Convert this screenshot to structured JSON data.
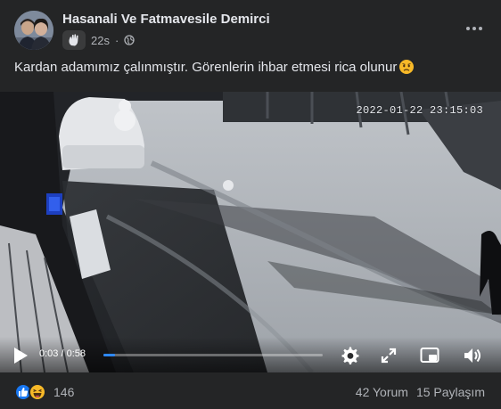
{
  "post": {
    "author": "Hasanali Ve Fatmavesile Demirci",
    "time": "22s",
    "audience_icon": "globe-icon",
    "badge_icon": "wave-hand-icon",
    "text": "Kardan adamımız çalınmıştır. Görenlerin ihbar etmesi rica olunur",
    "text_emoji": "sad-face-emoji"
  },
  "video": {
    "camera_timestamp": "2022-01-22 23:15:03",
    "time_display": "0:03 / 0:58",
    "progress": 0.052,
    "controls": [
      "play-icon",
      "settings-gear-icon",
      "fullscreen-expand-icon",
      "picture-in-picture-icon",
      "volume-icon"
    ]
  },
  "footer": {
    "reactions": [
      "like-icon",
      "haha-icon"
    ],
    "reaction_count": "146",
    "comments": "42 Yorum",
    "shares": "15 Paylaşım"
  },
  "colors": {
    "background": "#242526",
    "text_primary": "#e4e6eb",
    "text_secondary": "#b0b3b8",
    "accent": "#2d88ff",
    "like_blue": "#1877f2",
    "haha_yellow": "#f7b928"
  }
}
